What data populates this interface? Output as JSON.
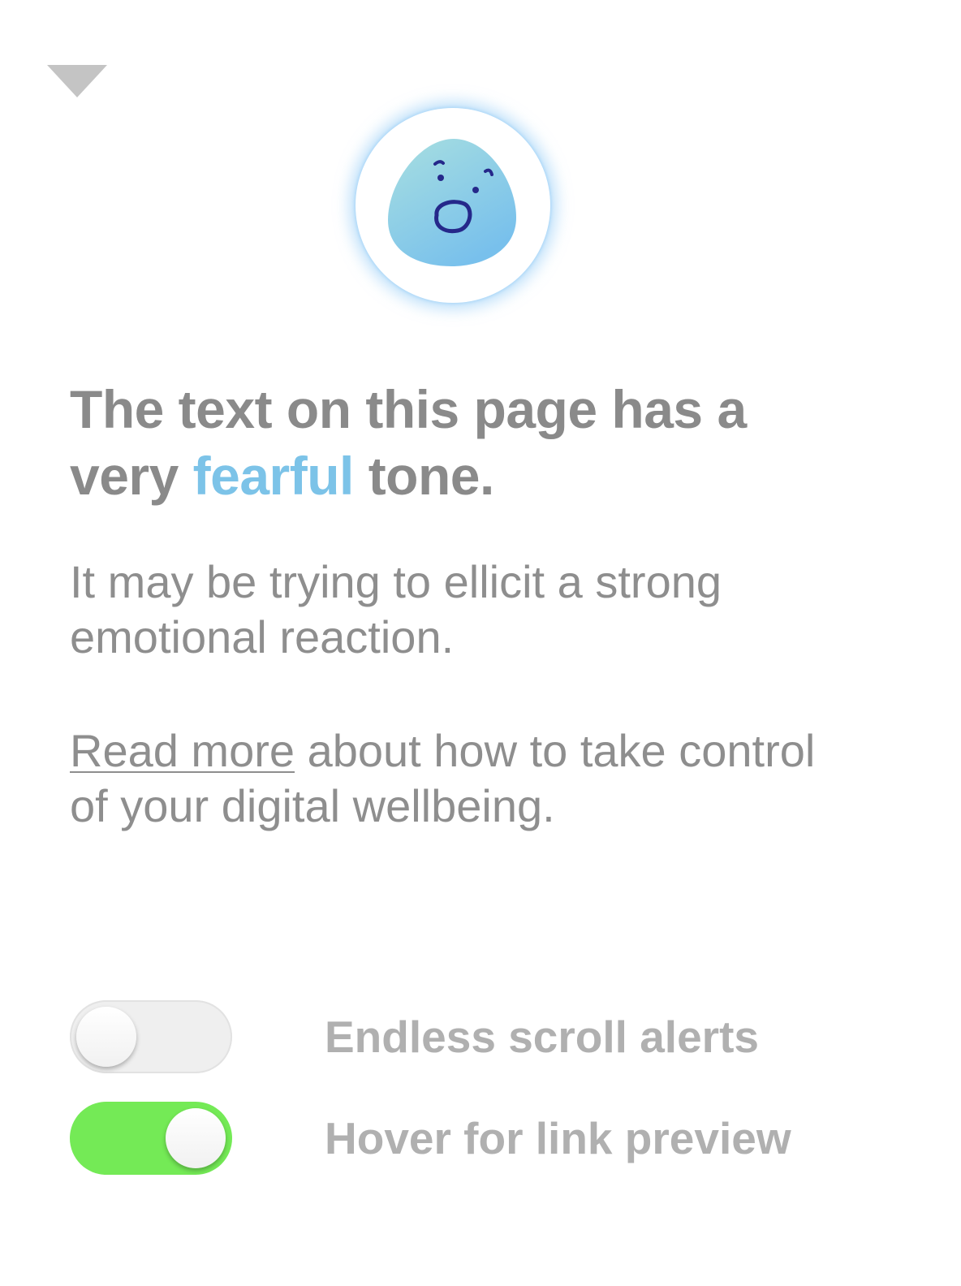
{
  "header": {
    "collapse_icon": "chevron-down-triangle-icon"
  },
  "mood": {
    "icon": "fearful-face-icon",
    "ring_glow_color": "#8cc8f5",
    "face_gradient": [
      "#a8dfe0",
      "#7cc3ea"
    ],
    "feature_color": "#25288a"
  },
  "headline": {
    "prefix": "The text on this page has a very ",
    "tone": "fearful",
    "suffix": " tone.",
    "accent_color": "#7cc3e8"
  },
  "description": {
    "text": "It may be trying to ellicit a strong emotional reaction."
  },
  "wellbeing": {
    "link_label": "Read more",
    "rest": " about how to take control of your digital wellbeing."
  },
  "settings": {
    "endless_scroll": {
      "label": "Endless scroll alerts",
      "state": "off"
    },
    "link_preview": {
      "label": "Hover for link preview",
      "state": "on"
    },
    "on_color": "#74ea56"
  }
}
